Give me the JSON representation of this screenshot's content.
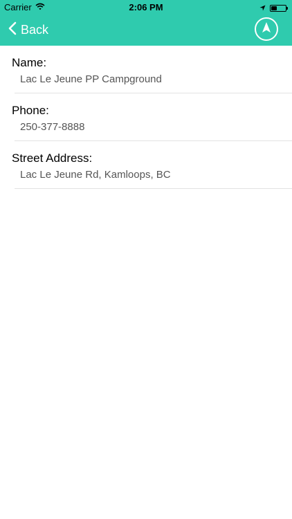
{
  "status_bar": {
    "carrier": "Carrier",
    "time": "2:06 PM"
  },
  "header": {
    "back_label": "Back",
    "background_color": "#2fcbae",
    "icons": {
      "back": "chevron-left-icon",
      "navigate": "navigation-arrow-icon"
    }
  },
  "details": {
    "name_label": "Name:",
    "name_value": "Lac Le Jeune PP Campground",
    "phone_label": "Phone:",
    "phone_value": "250-377-8888",
    "address_label": "Street Address:",
    "address_value": "Lac Le Jeune Rd, Kamloops, BC"
  }
}
